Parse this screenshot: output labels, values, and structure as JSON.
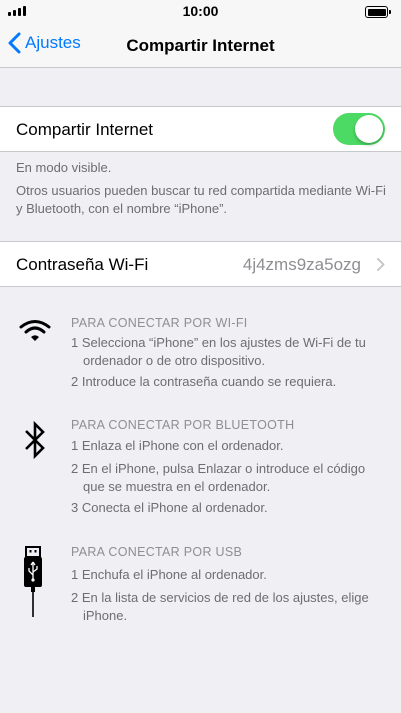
{
  "status_bar": {
    "time": "10:00"
  },
  "nav": {
    "back_label": "Ajustes",
    "title": "Compartir Internet"
  },
  "hotspot": {
    "label": "Compartir Internet",
    "enabled": true,
    "visible_note": "En modo visible.",
    "description": "Otros usuarios pueden buscar tu red compartida mediante Wi-Fi y Bluetooth, con el nombre “iPhone”."
  },
  "password": {
    "label": "Contraseña Wi-Fi",
    "value": "4j4zms9za5ozg"
  },
  "wifi": {
    "title": "PARA CONECTAR POR WI-FI",
    "steps": [
      "1 Selecciona “iPhone” en los ajustes de Wi-Fi de tu ordenador o de otro dispositivo.",
      "2 Introduce la contraseña cuando se requiera."
    ]
  },
  "bluetooth": {
    "title": "PARA CONECTAR POR BLUETOOTH",
    "steps": [
      "1 Enlaza el iPhone con el ordenador.",
      "2 En el iPhone, pulsa Enlazar o introduce el código que se muestra en el ordenador.",
      "3 Conecta el iPhone al ordenador."
    ]
  },
  "usb": {
    "title": "PARA CONECTAR POR USB",
    "steps": [
      "1 Enchufa el iPhone al ordenador.",
      "2 En la lista de servicios de red de los ajustes, elige iPhone."
    ]
  },
  "colors": {
    "accent": "#007aff",
    "toggle_on": "#4cd964",
    "background": "#efeff4"
  }
}
